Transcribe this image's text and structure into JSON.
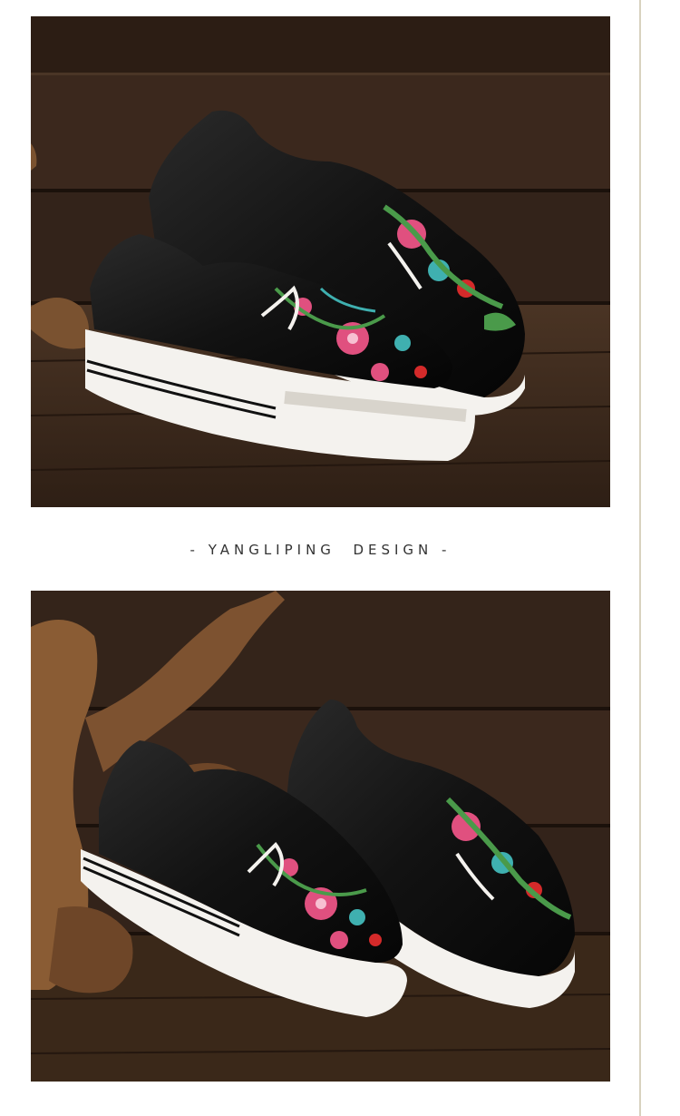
{
  "caption": {
    "text": "- YANGLIPING  DESIGN -"
  },
  "images": {
    "top": {
      "subject": "shoe-pair-photo",
      "colors": {
        "wood_dark": "#2a1a12",
        "wood_mid": "#3e2a1e",
        "wood_light": "#5a3f2e",
        "shoe_black": "#141414",
        "sole_white": "#f4f2ee",
        "embroidery_pink": "#e0507f",
        "embroidery_teal": "#3fb0b0",
        "embroidery_green": "#4a9a4a",
        "embroidery_red": "#d42a2a"
      }
    },
    "bottom": {
      "subject": "shoe-pair-with-driftwood-photo"
    }
  },
  "divider_color": "#d8d2bf"
}
